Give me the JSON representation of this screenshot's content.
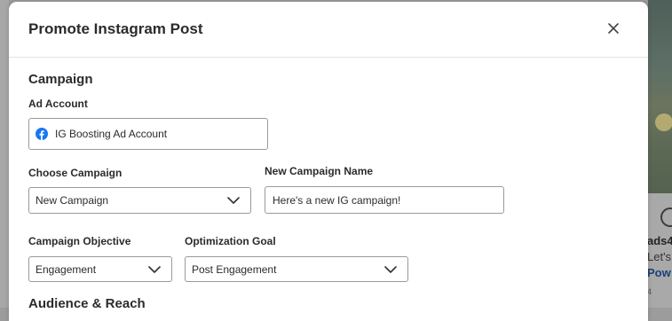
{
  "modal": {
    "title": "Promote Instagram Post",
    "close_icon": "close-icon"
  },
  "campaign": {
    "section_title": "Campaign",
    "ad_account": {
      "label": "Ad Account",
      "value": "IG Boosting Ad Account",
      "icon": "facebook-icon"
    },
    "choose_campaign": {
      "label": "Choose Campaign",
      "value": "New Campaign"
    },
    "new_campaign_name": {
      "label": "New Campaign Name",
      "value": "Here's a new IG campaign!"
    },
    "objective": {
      "label": "Campaign Objective",
      "value": "Engagement"
    },
    "optimization_goal": {
      "label": "Optimization Goal",
      "value": "Post Engagement"
    }
  },
  "audience": {
    "section_title": "Audience & Reach"
  },
  "background": {
    "line1": "ads4",
    "line2": "Let's",
    "line3": "Pow",
    "line4": "4"
  },
  "colors": {
    "facebook_blue": "#1877f2",
    "link_blue": "#1b3f7a"
  }
}
